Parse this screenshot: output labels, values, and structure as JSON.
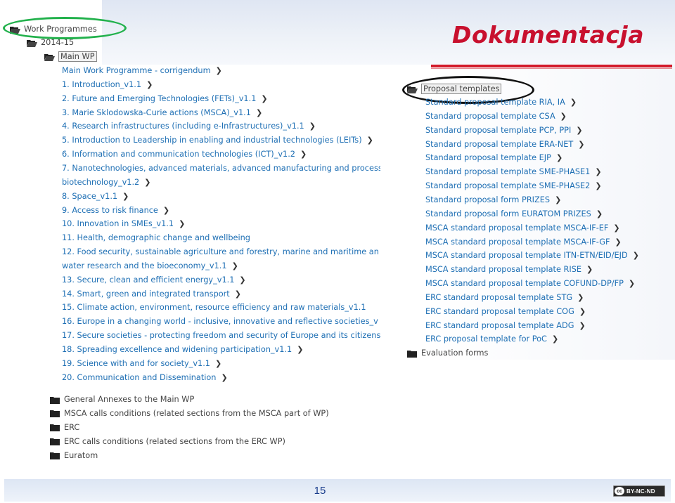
{
  "slide": {
    "title": "Dokumentacja",
    "page_number": "15",
    "license_badge": "BY-NC-ND",
    "cc_logo": "cc",
    "colors": {
      "title": "#c8102e",
      "link": "#1e6fb4",
      "highlight_green": "#22b14c"
    }
  },
  "left_tree": {
    "root": "Work Programmes",
    "year": "2014-15",
    "main_wp": "Main WP",
    "items": [
      "Main Work Programme - corrigendum",
      "1. Introduction_v1.1",
      "2. Future and Emerging Technologies (FETs)_v1.1",
      "3. Marie Sklodowska-Curie actions (MSCA)_v1.1",
      "4. Research infrastructures (including e-Infrastructures)_v1.1",
      "5. Introduction to Leadership in enabling and industrial technologies (LEITs)",
      "6. Information and communication technologies (ICT)_v1.2",
      "7. Nanotechnologies, advanced materials, advanced manufacturing and process",
      "biotechnology_v1.2",
      "8. Space_v1.1",
      "9. Access to risk finance",
      "10. Innovation in SMEs_v1.1",
      "11. Health, demographic change and wellbeing",
      "12. Food security, sustainable agriculture and forestry, marine and maritime an",
      "water research and the bioeconomy_v1.1",
      "13. Secure, clean and efficient energy_v1.1",
      "14. Smart, green and integrated transport",
      "15. Climate action, environment, resource efficiency and raw materials_v1.1",
      "16. Europe in a changing world - inclusive, innovative and reflective societies_v",
      "17. Secure societies - protecting freedom and security of Europe and its citizens",
      "18. Spreading excellence and widening participation_v1.1",
      "19. Science with and for society_v1.1",
      "20. Communication and Dissemination"
    ],
    "folders": [
      "General Annexes to the Main WP",
      "MSCA calls conditions (related sections from the MSCA part of WP)",
      "ERC",
      "ERC calls conditions (related sections from the ERC WP)",
      "Euratom"
    ]
  },
  "right_tree": {
    "root": "Proposal templates",
    "items": [
      "Standard proposal template RIA, IA",
      "Standard proposal template CSA",
      "Standard proposal template PCP, PPI",
      "Standard proposal template ERA-NET",
      "Standard proposal template EJP",
      "Standard proposal template SME-PHASE1",
      "Standard proposal template SME-PHASE2",
      "Standard proposal form PRIZES",
      "Standard proposal form EURATOM PRIZES",
      "MSCA standard proposal template MSCA-IF-EF",
      "MSCA standard proposal template MSCA-IF-GF",
      "MSCA standard proposal template ITN-ETN/EID/EJD",
      "MSCA standard proposal template RISE",
      "MSCA standard proposal template COFUND-DP/FP",
      "ERC standard proposal template STG",
      "ERC standard proposal template COG",
      "ERC standard proposal template ADG",
      "ERC proposal template for PoC"
    ],
    "evaluation_forms": "Evaluation forms"
  },
  "icons": {
    "open_folder": "folder-open-icon",
    "closed_folder": "folder-icon",
    "chevron": "chevron-right-icon"
  }
}
